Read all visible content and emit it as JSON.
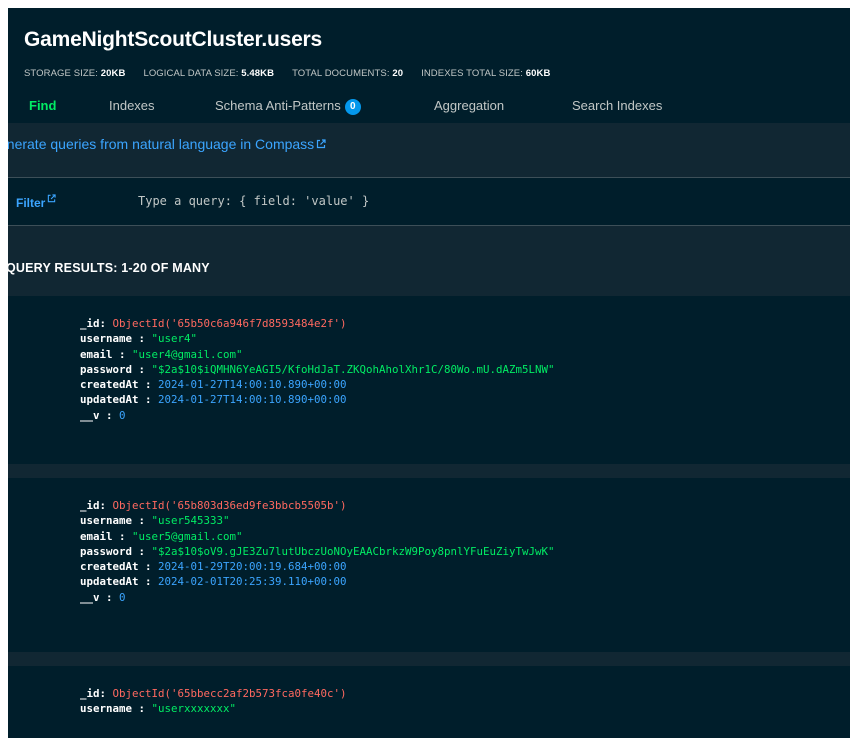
{
  "collection": {
    "title": "GameNightScoutCluster.users",
    "stats": [
      {
        "label": "STORAGE SIZE:",
        "value": "20KB"
      },
      {
        "label": "LOGICAL DATA SIZE:",
        "value": "5.48KB"
      },
      {
        "label": "TOTAL DOCUMENTS:",
        "value": "20"
      },
      {
        "label": "INDEXES TOTAL SIZE:",
        "value": "60KB"
      }
    ]
  },
  "tabs": [
    {
      "label": "Find",
      "active": true
    },
    {
      "label": "Indexes"
    },
    {
      "label": "Schema Anti-Patterns",
      "badge": "0"
    },
    {
      "label": "Aggregation"
    },
    {
      "label": "Search Indexes"
    }
  ],
  "banner": {
    "text": "enerate queries from natural language in Compass",
    "icon": "external-link-icon"
  },
  "filter": {
    "label": "Filter",
    "placeholder": "Type a query: { field: 'value' }"
  },
  "results": {
    "title": "QUERY RESULTS: 1-20 OF MANY"
  },
  "documents": [
    {
      "fields": [
        {
          "key": "_id",
          "value": "ObjectId('65b50c6a946f7d8593484e2f')",
          "type": "oid"
        },
        {
          "key": "username",
          "value": "\"user4\"",
          "type": "str"
        },
        {
          "key": "email",
          "value": "\"user4@gmail.com\"",
          "type": "str"
        },
        {
          "key": "password",
          "value": "\"$2a$10$iQMHN6YeAGI5/KfoHdJaT.ZKQohAholXhr1C/80Wo.mU.dAZm5LNW\"",
          "type": "str"
        },
        {
          "key": "createdAt",
          "value": "2024-01-27T14:00:10.890+00:00",
          "type": "date"
        },
        {
          "key": "updatedAt",
          "value": "2024-01-27T14:00:10.890+00:00",
          "type": "date"
        },
        {
          "key": "__v",
          "value": "0",
          "type": "num"
        }
      ]
    },
    {
      "fields": [
        {
          "key": "_id",
          "value": "ObjectId('65b803d36ed9fe3bbcb5505b')",
          "type": "oid"
        },
        {
          "key": "username",
          "value": "\"user545333\"",
          "type": "str"
        },
        {
          "key": "email",
          "value": "\"user5@gmail.com\"",
          "type": "str"
        },
        {
          "key": "password",
          "value": "\"$2a$10$oV9.gJE3Zu7lutUbczUoNOyEAACbrkzW9Poy8pnlYFuEuZiyTwJwK\"",
          "type": "str"
        },
        {
          "key": "createdAt",
          "value": "2024-01-29T20:00:19.684+00:00",
          "type": "date"
        },
        {
          "key": "updatedAt",
          "value": "2024-02-01T20:25:39.110+00:00",
          "type": "date"
        },
        {
          "key": "__v",
          "value": "0",
          "type": "num"
        }
      ]
    },
    {
      "fields": [
        {
          "key": "_id",
          "value": "ObjectId('65bbecc2af2b573fca0fe40c')",
          "type": "oid"
        },
        {
          "key": "username",
          "value": "\"userxxxxxxx\"",
          "type": "str"
        }
      ]
    }
  ],
  "colors": {
    "background": "#001e2b",
    "panel": "#112733",
    "accent_green": "#00ed64",
    "link_blue": "#3ba5ff",
    "objectid_red": "#ff6960",
    "badge_blue": "#0498ec"
  }
}
